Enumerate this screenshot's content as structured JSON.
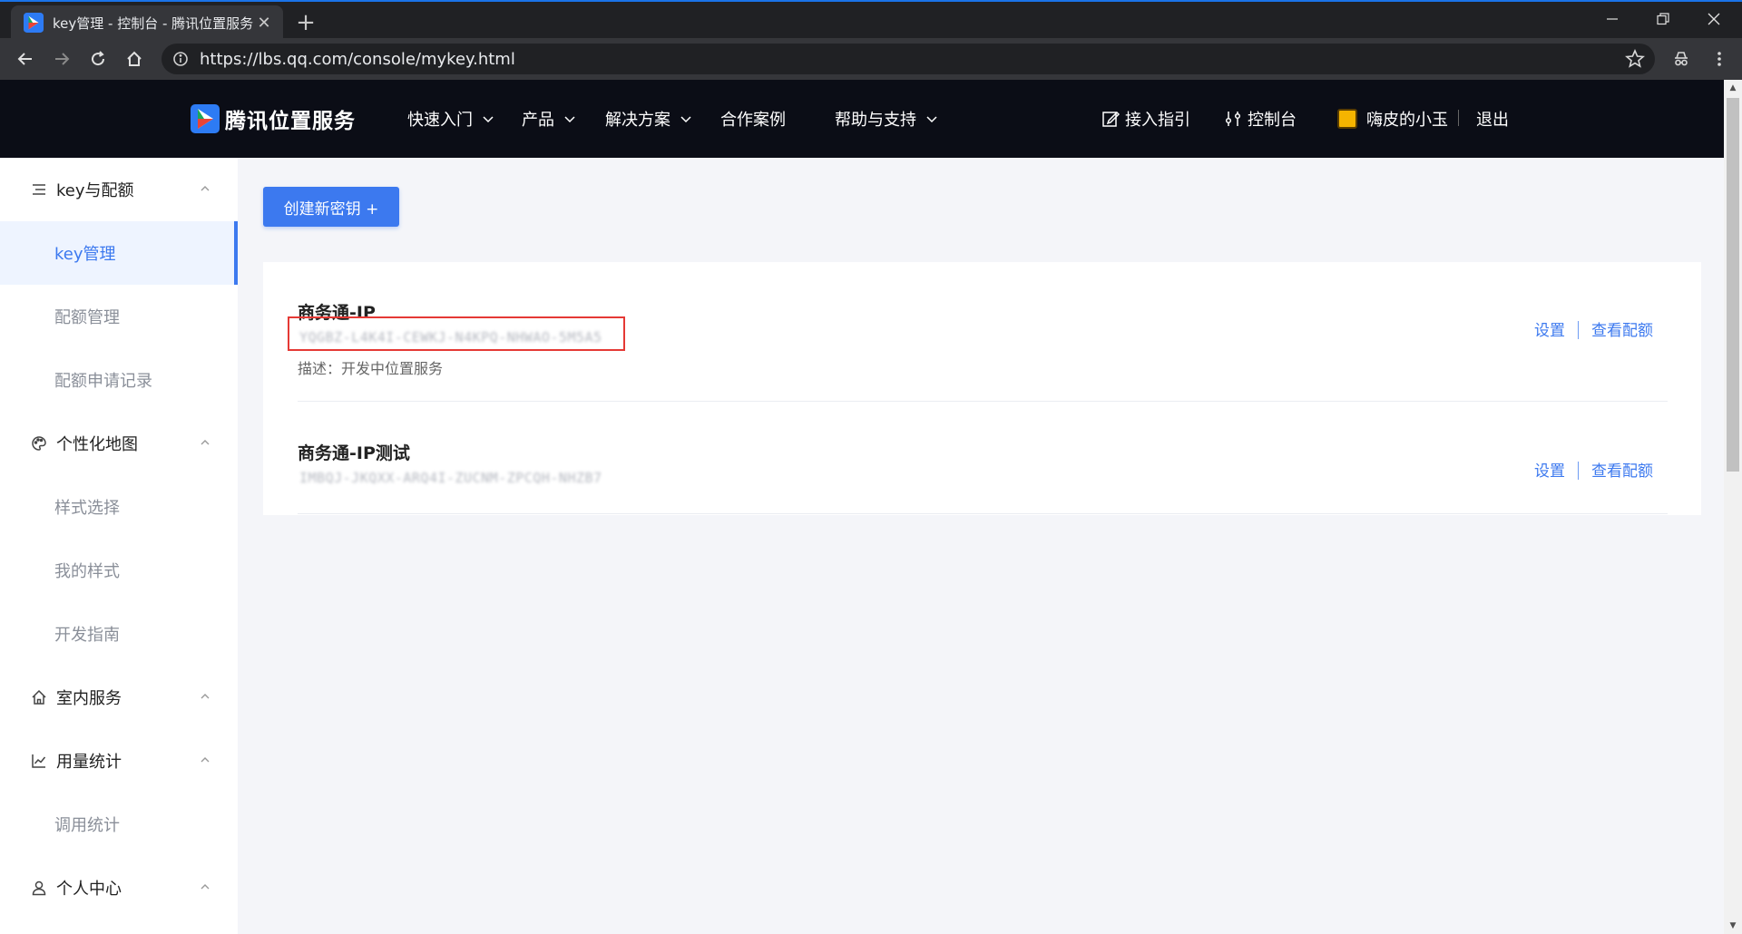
{
  "browser": {
    "tab_title": "key管理 - 控制台 - 腾讯位置服务",
    "url": "https://lbs.qq.com/console/mykey.html"
  },
  "header": {
    "brand": "腾讯位置服务",
    "nav": [
      {
        "label": "快速入门",
        "has_dropdown": true
      },
      {
        "label": "产品",
        "has_dropdown": true
      },
      {
        "label": "解决方案",
        "has_dropdown": true
      },
      {
        "label": "合作案例",
        "has_dropdown": false
      },
      {
        "label": "帮助与支持",
        "has_dropdown": true
      }
    ],
    "access_guide": "接入指引",
    "console": "控制台",
    "username": "嗨皮的小玉",
    "logout": "退出"
  },
  "sidebar": {
    "groups": [
      {
        "label": "key与配额",
        "icon": "list-icon",
        "items": [
          "key管理",
          "配额管理",
          "配额申请记录"
        ]
      },
      {
        "label": "个性化地图",
        "icon": "palette-icon",
        "items": [
          "样式选择",
          "我的样式",
          "开发指南"
        ]
      },
      {
        "label": "室内服务",
        "icon": "home-icon",
        "items": []
      },
      {
        "label": "用量统计",
        "icon": "chart-icon",
        "items": [
          "调用统计"
        ]
      },
      {
        "label": "个人中心",
        "icon": "user-icon",
        "items": []
      }
    ],
    "active_item": "key管理"
  },
  "main": {
    "create_button": "创建新密钥 +",
    "keys": [
      {
        "name": "商务通-IP",
        "key": "YQGBZ-L4K4I-CEWKJ-N4KPQ-NHWAO-5M5A5",
        "description": "描述：开发中位置服务",
        "settings": "设置",
        "quota": "查看配额"
      },
      {
        "name": "商务通-IP测试",
        "key": "IMBQJ-JKQXX-ARQ4I-ZUCNM-ZPCQH-NHZB7",
        "description": "",
        "settings": "设置",
        "quota": "查看配额"
      }
    ]
  },
  "colors": {
    "accent": "#3c79ef",
    "header_bg": "#0b0d16",
    "highlight": "#e53935"
  }
}
